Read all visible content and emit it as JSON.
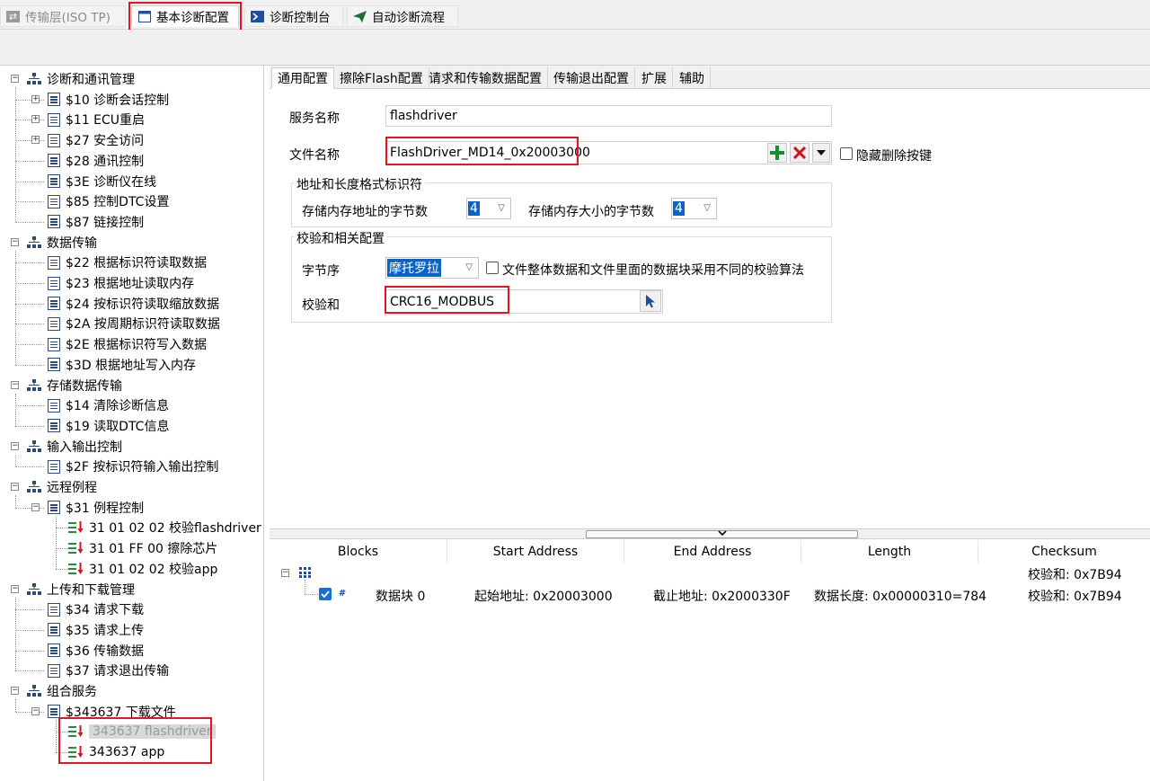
{
  "top_tabs": [
    {
      "label": "传输层(ISO TP)",
      "icon": "transfer-icon"
    },
    {
      "label": "基本诊断配置",
      "icon": "window-icon"
    },
    {
      "label": "诊断控制台",
      "icon": "console-icon"
    },
    {
      "label": "自动诊断流程",
      "icon": "send-icon"
    }
  ],
  "tree": {
    "groups": [
      {
        "label": "诊断和通讯管理",
        "items": [
          "$10 诊断会话控制",
          "$11 ECU重启",
          "$27 安全访问",
          "$28 通讯控制",
          "$3E 诊断仪在线",
          "$85 控制DTC设置",
          "$87 链接控制"
        ]
      },
      {
        "label": "数据传输",
        "items": [
          "$22 根据标识符读取数据",
          "$23 根据地址读取内存",
          "$24 按标识符读取缩放数据",
          "$2A 按周期标识符读取数据",
          "$2E 根据标识符写入数据",
          "$3D 根据地址写入内存"
        ]
      },
      {
        "label": "存储数据传输",
        "items": [
          "$14 清除诊断信息",
          "$19 读取DTC信息"
        ]
      },
      {
        "label": "输入输出控制",
        "items": [
          "$2F 按标识符输入输出控制"
        ]
      },
      {
        "label": "远程例程",
        "items": [
          "$31 例程控制"
        ],
        "steps": [
          "31 01 02 02 校验flashdriver",
          "31 01 FF 00 擦除芯片",
          "31 01 02 02 校验app"
        ]
      },
      {
        "label": "上传和下载管理",
        "items": [
          "$34 请求下载",
          "$35 请求上传",
          "$36 传输数据",
          "$37 请求退出传输"
        ]
      },
      {
        "label": "组合服务",
        "items": [
          "$343637 下载文件"
        ],
        "steps": [
          "343637 flashdriver",
          "343637 app"
        ]
      }
    ]
  },
  "panel_tabs": [
    "通用配置",
    "擦除Flash配置",
    "请求和传输数据配置",
    "传输退出配置",
    "扩展",
    "辅助"
  ],
  "form": {
    "service_name_label": "服务名称",
    "service_name_value": "flashdriver",
    "file_name_label": "文件名称",
    "file_name_value": "FlashDriver_MD14_0x20003000",
    "hide_delete_label": "隐藏删除按键",
    "addr_group_title": "地址和长度格式标识符",
    "addr_bytes_label": "存储内存地址的字节数",
    "addr_bytes_value": "4",
    "size_bytes_label": "存储内存大小的字节数",
    "size_bytes_value": "4",
    "checksum_group_title": "校验和相关配置",
    "byte_order_label": "字节序",
    "byte_order_value": "摩托罗拉",
    "diff_algo_label": "文件整体数据和文件里面的数据块采用不同的校验算法",
    "checksum_label": "校验和",
    "checksum_value": "CRC16_MODBUS"
  },
  "grid": {
    "headers": [
      "Blocks",
      "Start Address",
      "End Address",
      "Length",
      "Checksum"
    ],
    "root_checksum": "校验和: 0x7B94",
    "row": {
      "block": "数据块 0",
      "start": "起始地址: 0x20003000",
      "end": "截止地址: 0x2000330F",
      "length": "数据长度: 0x00000310=784",
      "checksum": "校验和: 0x7B94"
    }
  },
  "colors": {
    "highlight": "#e8141b",
    "tree_icon": "#2b4a7a",
    "add": "#1e8a2e",
    "remove": "#d6111c",
    "selection": "#0a64c8"
  }
}
